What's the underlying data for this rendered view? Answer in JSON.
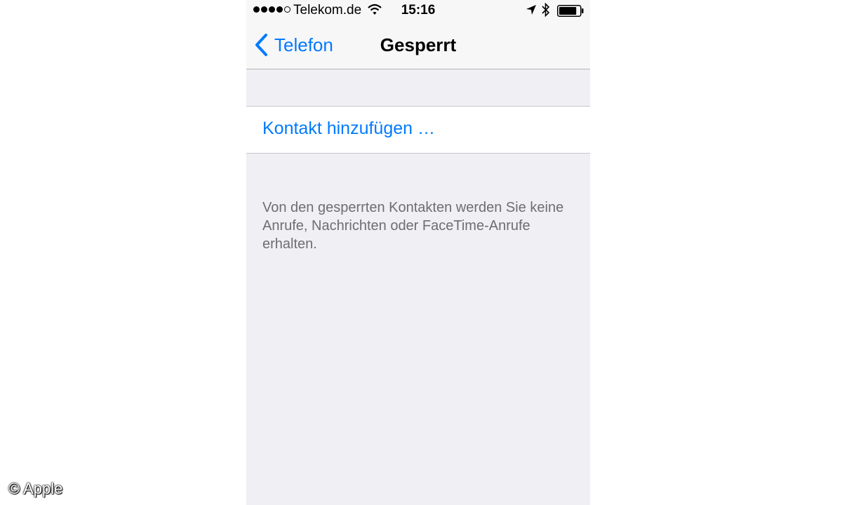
{
  "status_bar": {
    "carrier": "Telekom.de",
    "time": "15:16",
    "signal_bars_filled": 4,
    "signal_bars_total": 5,
    "icons": [
      "wifi-icon",
      "location-arrow-icon",
      "bluetooth-icon",
      "battery-icon"
    ],
    "battery_level": 0.85
  },
  "nav": {
    "back_label": "Telefon",
    "title": "Gesperrt"
  },
  "list": {
    "add_contact_label": "Kontakt hinzufügen …"
  },
  "footer": {
    "text": "Von den gesperrten Kontakten werden Sie keine Anrufe, Nachrichten oder FaceTime-Anrufe erhalten."
  },
  "watermark": {
    "text": "© Apple"
  },
  "colors": {
    "accent": "#007aff",
    "background": "#efeff4",
    "footer_text": "#6d6d72"
  }
}
